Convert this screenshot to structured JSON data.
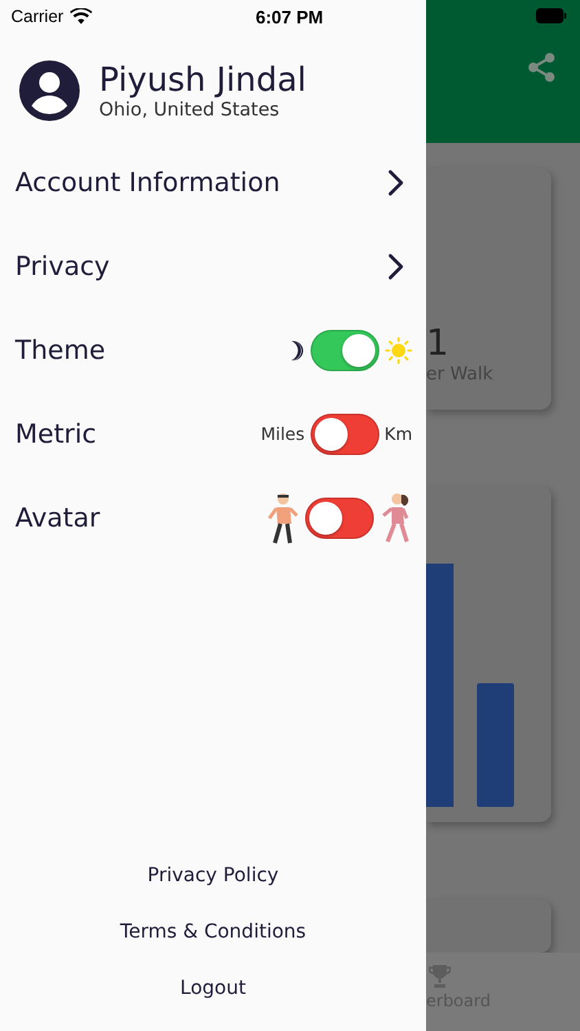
{
  "status_bar": {
    "carrier": "Carrier",
    "time": "6:07 PM"
  },
  "profile": {
    "name": "Piyush Jindal",
    "location": "Ohio, United States"
  },
  "menu": [
    {
      "label": "Account Information",
      "kind": "link"
    },
    {
      "label": "Privacy",
      "kind": "link"
    },
    {
      "label": "Theme",
      "kind": "daynight",
      "on": true
    },
    {
      "label": "Metric",
      "kind": "units",
      "on": false,
      "left_label": "Miles",
      "right_label": "Km"
    },
    {
      "label": "Avatar",
      "kind": "avatar",
      "on": false
    }
  ],
  "footer_links": [
    "Privacy Policy",
    "Terms & Conditions",
    "Logout"
  ],
  "background": {
    "stat_value": "1",
    "stat_label": "er Walk",
    "tab_label": "erboard"
  }
}
